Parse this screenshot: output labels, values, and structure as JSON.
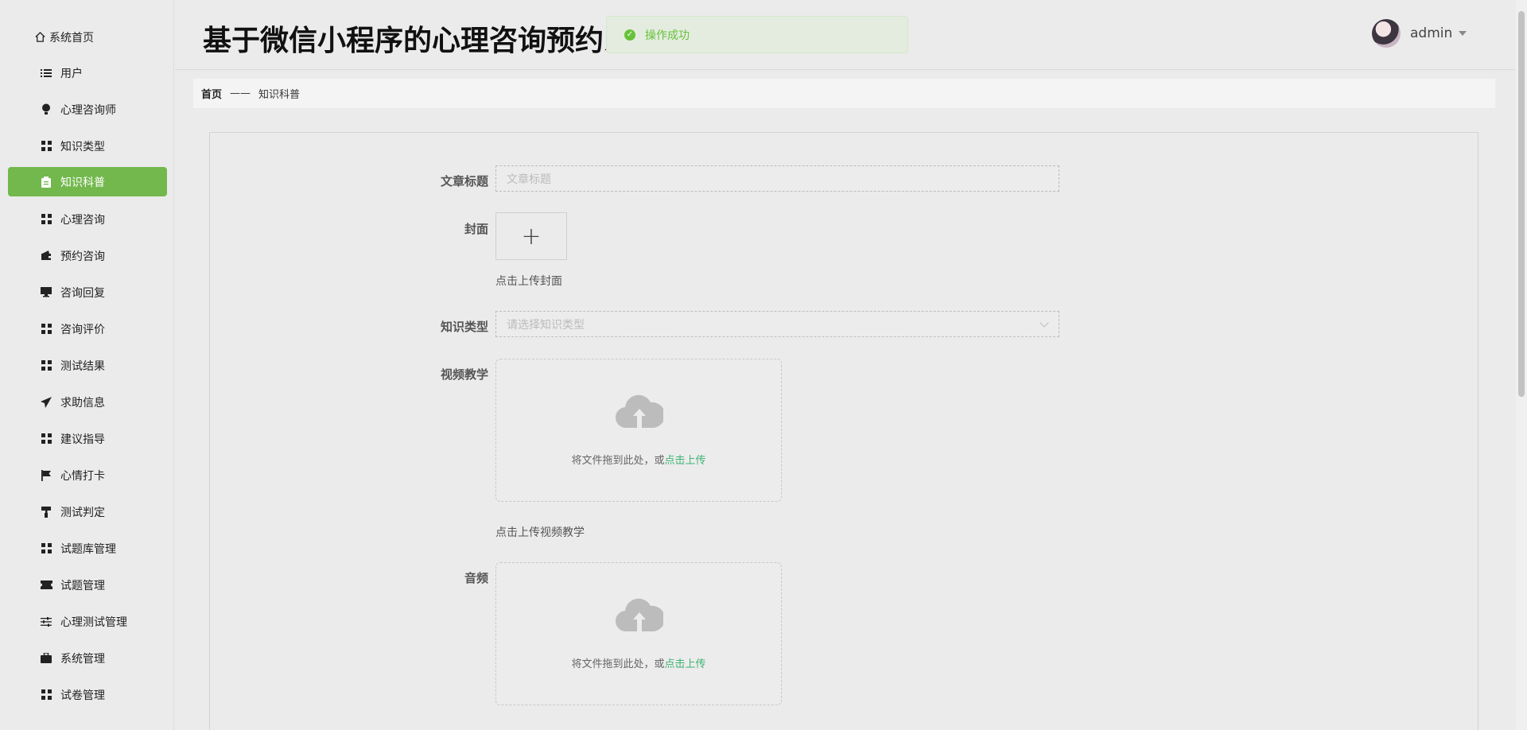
{
  "sidebar": {
    "items": [
      {
        "label": "系统首页",
        "icon": "home-icon"
      },
      {
        "label": "用户",
        "icon": "list-icon"
      },
      {
        "label": "心理咨询师",
        "icon": "bulb-icon"
      },
      {
        "label": "知识类型",
        "icon": "grid-icon"
      },
      {
        "label": "知识科普",
        "icon": "clipboard-icon",
        "active": true
      },
      {
        "label": "心理咨询",
        "icon": "grid-icon"
      },
      {
        "label": "预约咨询",
        "icon": "wallet-icon"
      },
      {
        "label": "咨询回复",
        "icon": "monitor-icon"
      },
      {
        "label": "咨询评价",
        "icon": "grid-icon"
      },
      {
        "label": "测试结果",
        "icon": "grid-icon"
      },
      {
        "label": "求助信息",
        "icon": "send-icon"
      },
      {
        "label": "建议指导",
        "icon": "grid-icon"
      },
      {
        "label": "心情打卡",
        "icon": "flag-icon"
      },
      {
        "label": "测试判定",
        "icon": "paint-roller-icon"
      },
      {
        "label": "试题库管理",
        "icon": "grid-icon"
      },
      {
        "label": "试题管理",
        "icon": "ticket-icon"
      },
      {
        "label": "心理测试管理",
        "icon": "sliders-icon"
      },
      {
        "label": "系统管理",
        "icon": "briefcase-icon"
      },
      {
        "label": "试卷管理",
        "icon": "grid-icon"
      }
    ]
  },
  "header": {
    "title": "基于微信小程序的心理咨询预约系统",
    "toast": "操作成功",
    "username": "admin"
  },
  "breadcrumb": {
    "home": "首页",
    "separator": "——",
    "current": "知识科普"
  },
  "form": {
    "title_label": "文章标题",
    "title_placeholder": "文章标题",
    "cover_label": "封面",
    "cover_hint": "点击上传封面",
    "type_label": "知识类型",
    "type_placeholder": "请选择知识类型",
    "video_label": "视频教学",
    "video_drop_text": "将文件拖到此处，或",
    "video_drop_link": "点击上传",
    "video_hint": "点击上传视频教学",
    "audio_label": "音频",
    "audio_drop_text": "将文件拖到此处，或",
    "audio_drop_link": "点击上传"
  },
  "colors": {
    "accent": "#72b84c",
    "success": "#67c23a",
    "link": "#3cb371"
  }
}
